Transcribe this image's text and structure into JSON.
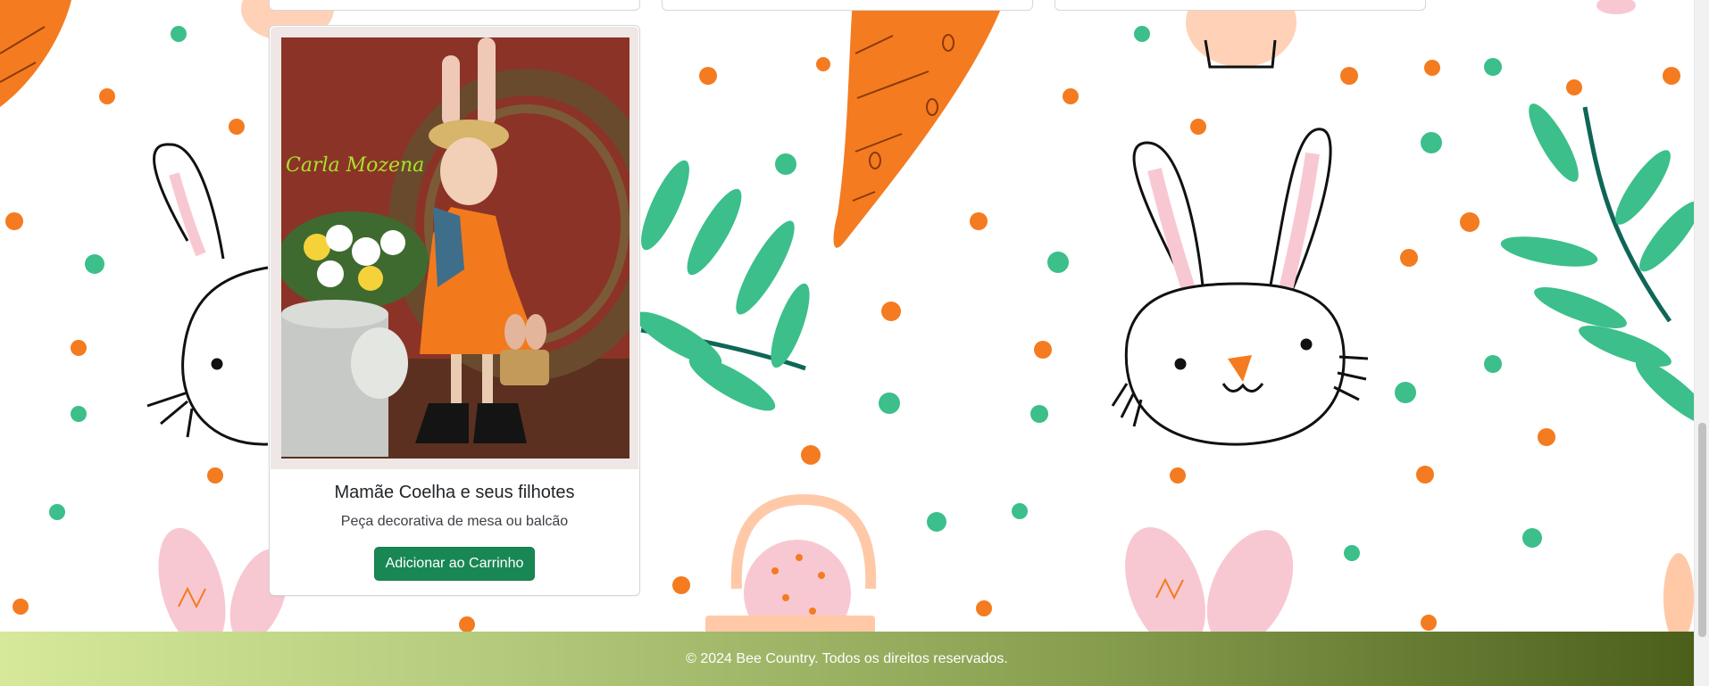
{
  "product": {
    "image_signature": "Carla Mozena",
    "title": "Mamãe Coelha e seus filhotes",
    "description": "Peça decorativa de mesa ou balcão",
    "add_to_cart_label": "Adicionar ao Carrinho"
  },
  "footer": {
    "text": "© 2024 Bee Country. Todos os direitos reservados."
  },
  "colors": {
    "button": "#198754",
    "footer_gradient_start": "#d6e99a",
    "footer_gradient_end": "#4b5f1b",
    "pattern_orange": "#f47b20",
    "pattern_green": "#3cbf8a",
    "pattern_pink": "#f8c8d2"
  },
  "icons": [
    "bunny-icon",
    "carrot-icon",
    "leaf-branch-icon",
    "basket-icon",
    "cart-icon"
  ]
}
